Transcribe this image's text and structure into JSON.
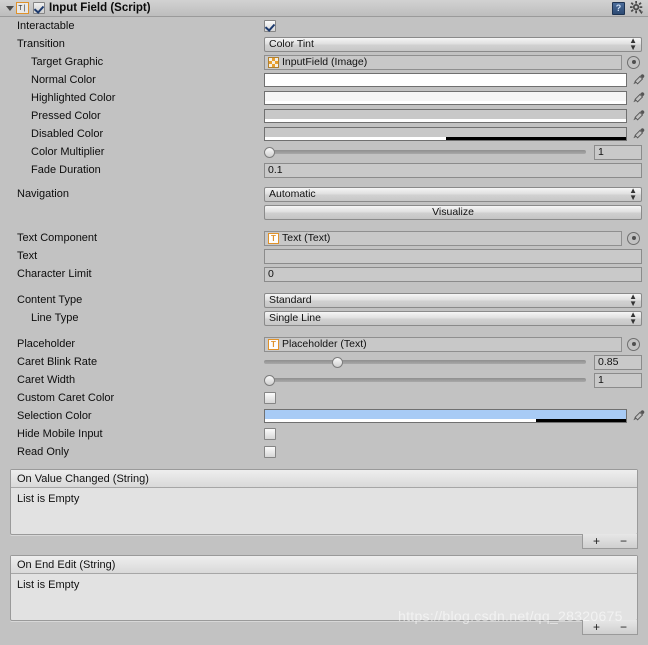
{
  "header": {
    "title": "Input Field (Script)",
    "script_icon": "T|",
    "enabled": true,
    "help_icon": "book-help-icon",
    "settings_icon": "gear-icon"
  },
  "properties": {
    "interactable": {
      "label": "Interactable",
      "checked": true
    },
    "transition": {
      "label": "Transition",
      "value": "Color Tint"
    },
    "target_graphic": {
      "label": "Target Graphic",
      "value": "InputField (Image)"
    },
    "normal_color": {
      "label": "Normal Color",
      "color": "#FFFFFF",
      "alpha_pct": 100
    },
    "highlighted_color": {
      "label": "Highlighted Color",
      "color": "#F5F5F5",
      "alpha_pct": 100
    },
    "pressed_color": {
      "label": "Pressed Color",
      "color": "#C8C8C8",
      "alpha_pct": 100
    },
    "disabled_color": {
      "label": "Disabled Color",
      "color": "#C8C8C8",
      "alpha_pct": 50
    },
    "color_multiplier": {
      "label": "Color Multiplier",
      "value": "1",
      "slider_pct": 0
    },
    "fade_duration": {
      "label": "Fade Duration",
      "value": "0.1"
    },
    "navigation": {
      "label": "Navigation",
      "value": "Automatic"
    },
    "visualize": {
      "label": "Visualize"
    },
    "text_component": {
      "label": "Text Component",
      "value": "Text (Text)"
    },
    "text": {
      "label": "Text",
      "value": ""
    },
    "character_limit": {
      "label": "Character Limit",
      "value": "0"
    },
    "content_type": {
      "label": "Content Type",
      "value": "Standard"
    },
    "line_type": {
      "label": "Line Type",
      "value": "Single Line"
    },
    "placeholder": {
      "label": "Placeholder",
      "value": "Placeholder (Text)"
    },
    "caret_blink_rate": {
      "label": "Caret Blink Rate",
      "value": "0.85",
      "slider_pct": 21
    },
    "caret_width": {
      "label": "Caret Width",
      "value": "1",
      "slider_pct": 0
    },
    "custom_caret_color": {
      "label": "Custom Caret Color",
      "checked": false
    },
    "selection_color": {
      "label": "Selection Color",
      "color": "#A8CBF5",
      "alpha_pct": 75
    },
    "hide_mobile_input": {
      "label": "Hide Mobile Input",
      "checked": false
    },
    "read_only": {
      "label": "Read Only",
      "checked": false
    }
  },
  "events": [
    {
      "title": "On Value Changed (String)",
      "body": "List is Empty",
      "add_label": "+",
      "remove_label": "−"
    },
    {
      "title": "On End Edit (String)",
      "body": "List is Empty",
      "add_label": "+",
      "remove_label": "−"
    }
  ],
  "watermark": "https://blog.csdn.net/qq_28320675"
}
